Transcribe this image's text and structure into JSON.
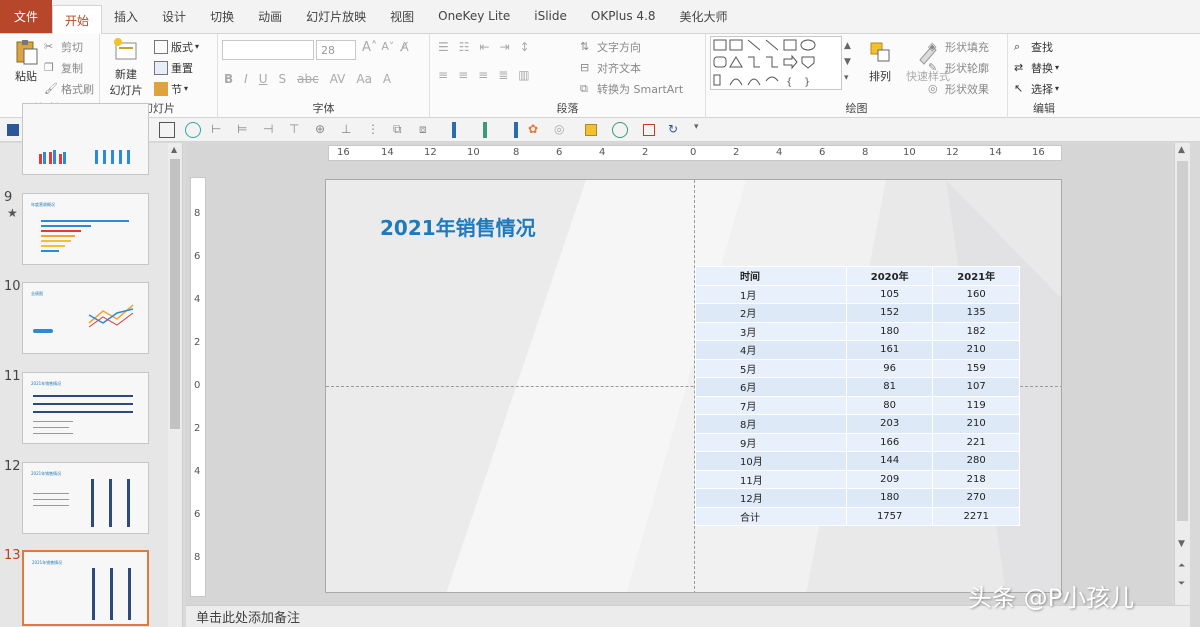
{
  "menu": {
    "tabs": [
      "文件",
      "开始",
      "插入",
      "设计",
      "切换",
      "动画",
      "幻灯片放映",
      "视图",
      "OneKey Lite",
      "iSlide",
      "OKPlus 4.8",
      "美化大师"
    ],
    "active_index": 1
  },
  "ribbon": {
    "clipboard": {
      "label": "剪贴板",
      "paste": "粘贴",
      "cut": "剪切",
      "copy": "复制",
      "format_painter": "格式刷"
    },
    "slides": {
      "label": "幻灯片",
      "new_slide": "新建",
      "new_slide2": "幻灯片",
      "layout": "版式",
      "reset": "重置",
      "section": "节"
    },
    "font": {
      "label": "字体",
      "size": "28"
    },
    "paragraph": {
      "label": "段落",
      "text_direction": "文字方向",
      "align_text": "对齐文本",
      "smartart": "转换为 SmartArt"
    },
    "drawing": {
      "label": "绘图",
      "arrange": "排列",
      "quick_styles": "快速样式",
      "fill": "形状填充",
      "outline": "形状轮廓",
      "effects": "形状效果"
    },
    "editing": {
      "label": "编辑",
      "find": "查找",
      "replace": "替换",
      "select": "选择"
    }
  },
  "thumbnails": [
    {
      "num": "9",
      "star": "★",
      "title": "年度营收概况"
    },
    {
      "num": "10",
      "title": "业绩图"
    },
    {
      "num": "11",
      "title": "2021年销售情况"
    },
    {
      "num": "12",
      "title": "2021年销售情况"
    },
    {
      "num": "13",
      "title": "2021年销售情况"
    }
  ],
  "ruler": {
    "h": [
      "16",
      "14",
      "12",
      "10",
      "8",
      "6",
      "4",
      "2",
      "0",
      "2",
      "4",
      "6",
      "8",
      "10",
      "12",
      "14",
      "16"
    ],
    "v": [
      "8",
      "6",
      "4",
      "2",
      "0",
      "2",
      "4",
      "6",
      "8"
    ]
  },
  "slide": {
    "title": "2021年销售情况",
    "table": {
      "headers": [
        "时间",
        "2020年",
        "2021年"
      ],
      "rows": [
        [
          "1月",
          "105",
          "160"
        ],
        [
          "2月",
          "152",
          "135"
        ],
        [
          "3月",
          "180",
          "182"
        ],
        [
          "4月",
          "161",
          "210"
        ],
        [
          "5月",
          "96",
          "159"
        ],
        [
          "6月",
          "81",
          "107"
        ],
        [
          "7月",
          "80",
          "119"
        ],
        [
          "8月",
          "203",
          "210"
        ],
        [
          "9月",
          "166",
          "221"
        ],
        [
          "10月",
          "144",
          "280"
        ],
        [
          "11月",
          "209",
          "218"
        ],
        [
          "12月",
          "180",
          "270"
        ],
        [
          "合计",
          "1757",
          "2271"
        ]
      ]
    }
  },
  "notes": {
    "placeholder": "单击此处添加备注"
  },
  "watermark": "头条 @P小孩儿",
  "colors": {
    "accent": "#b7472a",
    "title_blue": "#1d7bbd",
    "table_fill": "#e7f0fb",
    "current_thumb_border": "#e4773e"
  }
}
